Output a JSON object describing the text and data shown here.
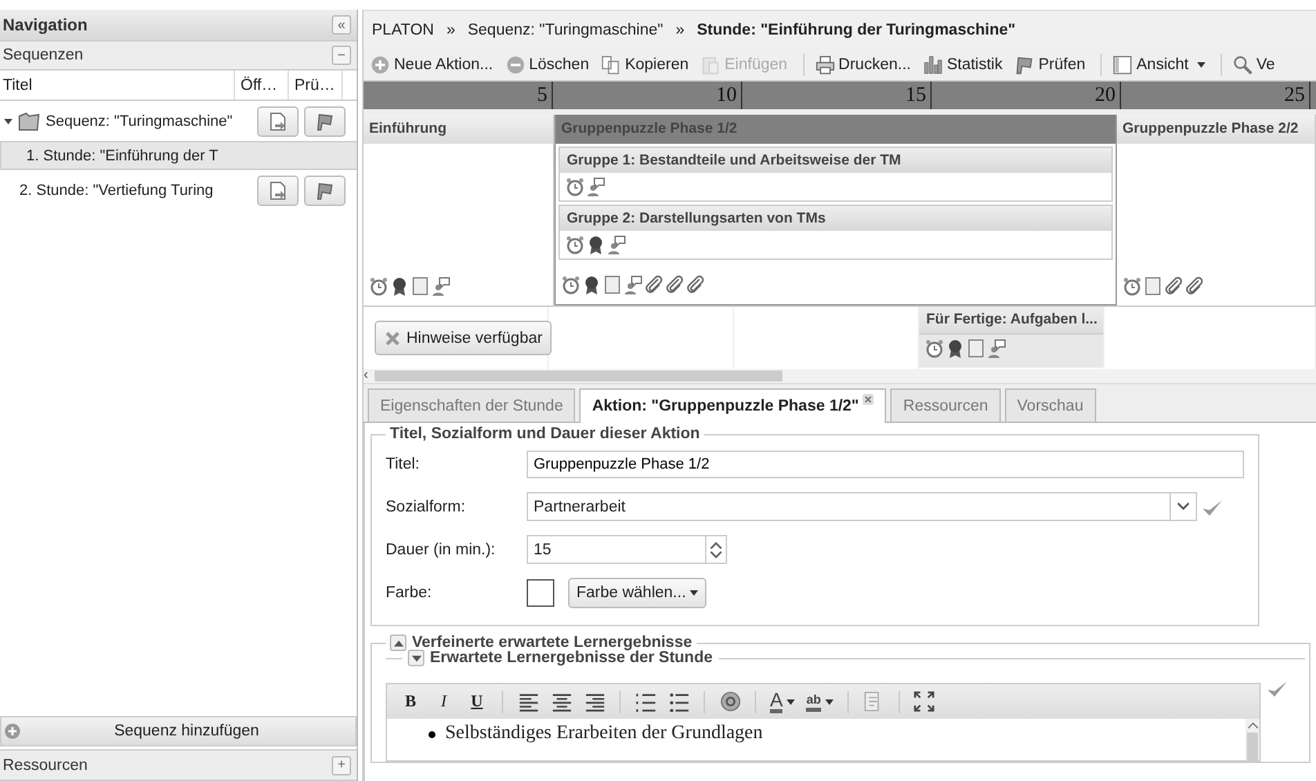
{
  "navigation": {
    "title": "Navigation",
    "collapse_symbol": "«"
  },
  "sequences": {
    "title": "Sequenzen",
    "collapse_symbol": "−",
    "columns": [
      "Titel",
      "Öff…",
      "Prü…"
    ],
    "rows": [
      {
        "label": "Sequenz: \"Turingmaschine\"",
        "expanded": true,
        "selected": false,
        "children": [
          {
            "label": "1. Stunde: \"Einführung der T",
            "selected": true
          },
          {
            "label": "2. Stunde: \"Vertiefung Turing",
            "selected": false
          }
        ]
      }
    ]
  },
  "add_sequence": "Sequenz hinzufügen",
  "resources": {
    "title": "Ressourcen",
    "expand_symbol": "+"
  },
  "breadcrumb": [
    {
      "kind": "link",
      "label": "PLATON"
    },
    {
      "kind": "sep",
      "label": "»"
    },
    {
      "kind": "link",
      "label": "Sequenz: \"Turingmaschine\""
    },
    {
      "kind": "sep",
      "label": "»"
    },
    {
      "kind": "current",
      "label": "Stunde: \"Einführung der Turingmaschine\""
    }
  ],
  "toolbar": [
    {
      "kind": "add",
      "label": "Neue Aktion...",
      "disabled": false
    },
    {
      "kind": "remove",
      "label": "Löschen",
      "disabled": false
    },
    {
      "kind": "copy",
      "label": "Kopieren",
      "disabled": false
    },
    {
      "kind": "paste",
      "label": "Einfügen",
      "disabled": true
    },
    {
      "kind": "sep"
    },
    {
      "kind": "print",
      "label": "Drucken...",
      "disabled": false
    },
    {
      "kind": "chart",
      "label": "Statistik",
      "disabled": false
    },
    {
      "kind": "flag",
      "label": "Prüfen",
      "disabled": false
    },
    {
      "kind": "sep"
    },
    {
      "kind": "view",
      "label": "Ansicht",
      "disabled": false,
      "dropdown": true
    },
    {
      "kind": "sep"
    },
    {
      "kind": "search",
      "label": "Ve",
      "disabled": false
    }
  ],
  "ruler": [
    "5",
    "10",
    "15",
    "20",
    "25"
  ],
  "actions": [
    {
      "title": "Einführung",
      "selected": false,
      "markers": [
        {
          "kind": "timer"
        },
        {
          "kind": "award"
        },
        {
          "kind": "note"
        },
        {
          "kind": "comment"
        }
      ]
    },
    {
      "title": "Gruppenpuzzle Phase 1/2",
      "selected": true,
      "groups": [
        {
          "title": "Gruppe 1: Bestandteile und Arbeitsweise der TM",
          "markers": [
            {
              "kind": "timer"
            },
            {
              "kind": "comment"
            }
          ]
        },
        {
          "title": "Gruppe 2: Darstellungsarten von TMs",
          "markers": [
            {
              "kind": "timer"
            },
            {
              "kind": "award"
            },
            {
              "kind": "comment"
            }
          ]
        }
      ],
      "markers": [
        {
          "kind": "timer"
        },
        {
          "kind": "award"
        },
        {
          "kind": "note"
        },
        {
          "kind": "comment"
        },
        {
          "kind": "attachment"
        },
        {
          "kind": "attachment"
        },
        {
          "kind": "attachment"
        }
      ]
    },
    {
      "title": "Gruppenpuzzle Phase 2/2",
      "selected": false,
      "markers": [
        {
          "kind": "timer"
        },
        {
          "kind": "note"
        },
        {
          "kind": "attachment"
        },
        {
          "kind": "attachment"
        }
      ]
    }
  ],
  "second_row": [
    {
      "kind": "button",
      "label": "Hinweise verfügbar"
    },
    {
      "kind": "empty"
    },
    {
      "kind": "empty"
    },
    {
      "kind": "action",
      "title": "Für Fertige: Aufgaben l...",
      "markers": [
        {
          "kind": "timer"
        },
        {
          "kind": "award"
        },
        {
          "kind": "note"
        },
        {
          "kind": "comment"
        }
      ]
    },
    {
      "kind": "empty"
    }
  ],
  "scroll_left": "‹",
  "tabs": [
    {
      "label": "Eigenschaften der Stunde",
      "selected": false,
      "closable": false
    },
    {
      "label": "Aktion: \"Gruppenpuzzle Phase 1/2\"",
      "selected": true,
      "closable": true
    },
    {
      "label": "Ressourcen",
      "selected": false,
      "closable": false
    },
    {
      "label": "Vorschau",
      "selected": false,
      "closable": false
    }
  ],
  "form": {
    "legend": "Titel, Sozialform und Dauer dieser Aktion",
    "title": {
      "label": "Titel:",
      "value": "Gruppenpuzzle Phase 1/2"
    },
    "social_form": {
      "label": "Sozialform:",
      "value": "Partnerarbeit",
      "valid": true
    },
    "duration": {
      "label": "Dauer (in min.):",
      "value": "15"
    },
    "color": {
      "label": "Farbe:",
      "button": "Farbe wählen..."
    }
  },
  "outcomes": {
    "legend": "Verfeinerte erwartete Lernergebnisse",
    "expanded": true,
    "sub": {
      "legend": "Erwartete Lernergebnisse der Stunde",
      "expanded": false
    },
    "editor_toolbar": [
      {
        "kind": "bold",
        "label": "B"
      },
      {
        "kind": "italic",
        "label": "I"
      },
      {
        "kind": "underline",
        "label": "U"
      },
      {
        "kind": "sep"
      },
      {
        "kind": "align-left"
      },
      {
        "kind": "align-center"
      },
      {
        "kind": "align-right"
      },
      {
        "kind": "sep"
      },
      {
        "kind": "ordered-list"
      },
      {
        "kind": "bullet-list"
      },
      {
        "kind": "sep"
      },
      {
        "kind": "link"
      },
      {
        "kind": "sep"
      },
      {
        "kind": "font-color",
        "label": "A"
      },
      {
        "kind": "highlight",
        "label": "ab"
      },
      {
        "kind": "sep"
      },
      {
        "kind": "source"
      },
      {
        "kind": "sep"
      },
      {
        "kind": "fullscreen"
      }
    ],
    "saved": true,
    "items": [
      "Selbständiges Erarbeiten der Grundlagen"
    ]
  }
}
